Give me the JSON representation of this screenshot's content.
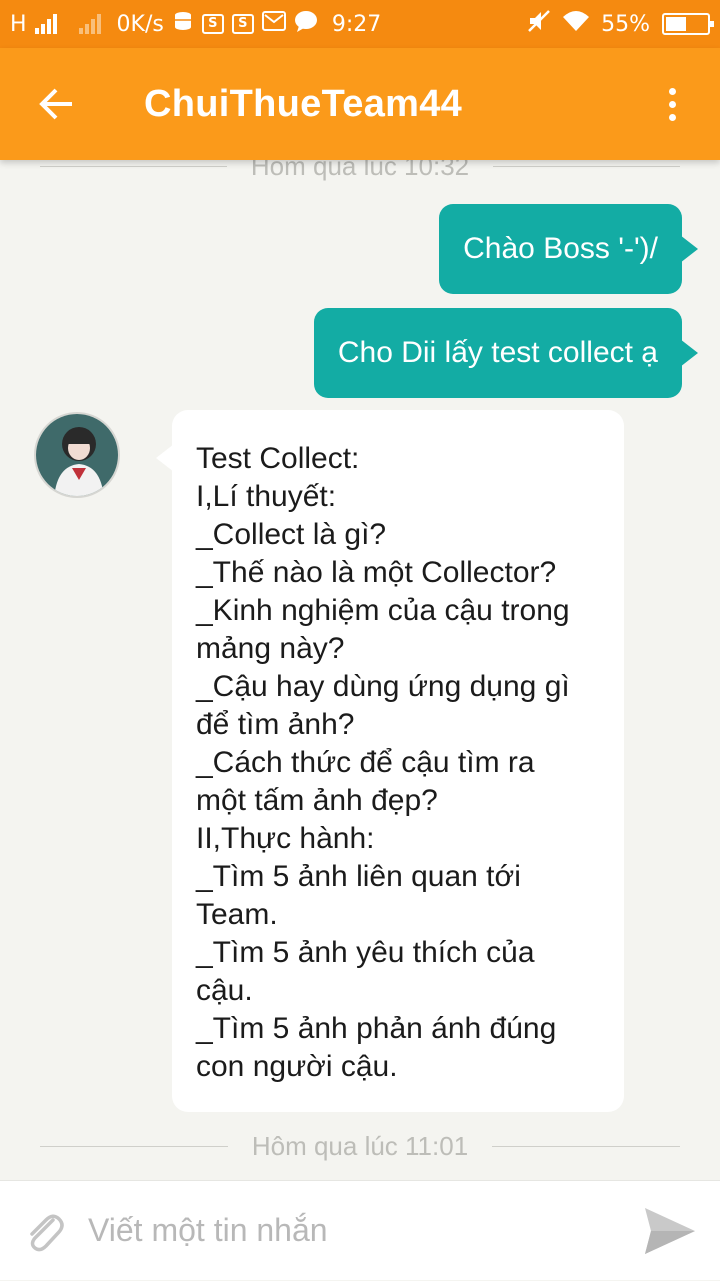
{
  "status_bar": {
    "network_type": "H",
    "speed": "0K/s",
    "time": "9:27",
    "battery_percent": "55%",
    "battery_level": 0.55,
    "sim_badge_1": "S",
    "sim_badge_2": "S"
  },
  "app_bar": {
    "title": "ChuiThueTeam44",
    "accent_color": "#fb9a1a"
  },
  "chat": {
    "divider_top": "Hôm qua lúc 10:32",
    "outgoing": [
      {
        "text": "Chào Boss '-')/"
      },
      {
        "text": "Cho Dii lấy test collect ạ"
      }
    ],
    "incoming_lines": [
      "Test Collect:",
      "I,Lí thuyết:",
      "_Collect là gì?",
      "_Thế nào là một Collector?",
      "_Kinh nghiệm của cậu trong",
      "mảng này?",
      "_Cậu hay dùng ứng dụng gì",
      "để tìm ảnh?",
      "_Cách thức để cậu tìm ra",
      "một tấm ảnh đẹp?",
      "II,Thực hành:",
      "_Tìm 5 ảnh liên quan tới",
      "Team.",
      "_Tìm 5 ảnh yêu thích của",
      "cậu.",
      "_Tìm 5 ảnh phản ánh đúng",
      "con người cậu."
    ],
    "divider_bottom": "Hôm qua lúc 11:01",
    "outgoing_color": "#13aca4"
  },
  "composer": {
    "placeholder": "Viết một tin nhắn",
    "value": ""
  }
}
